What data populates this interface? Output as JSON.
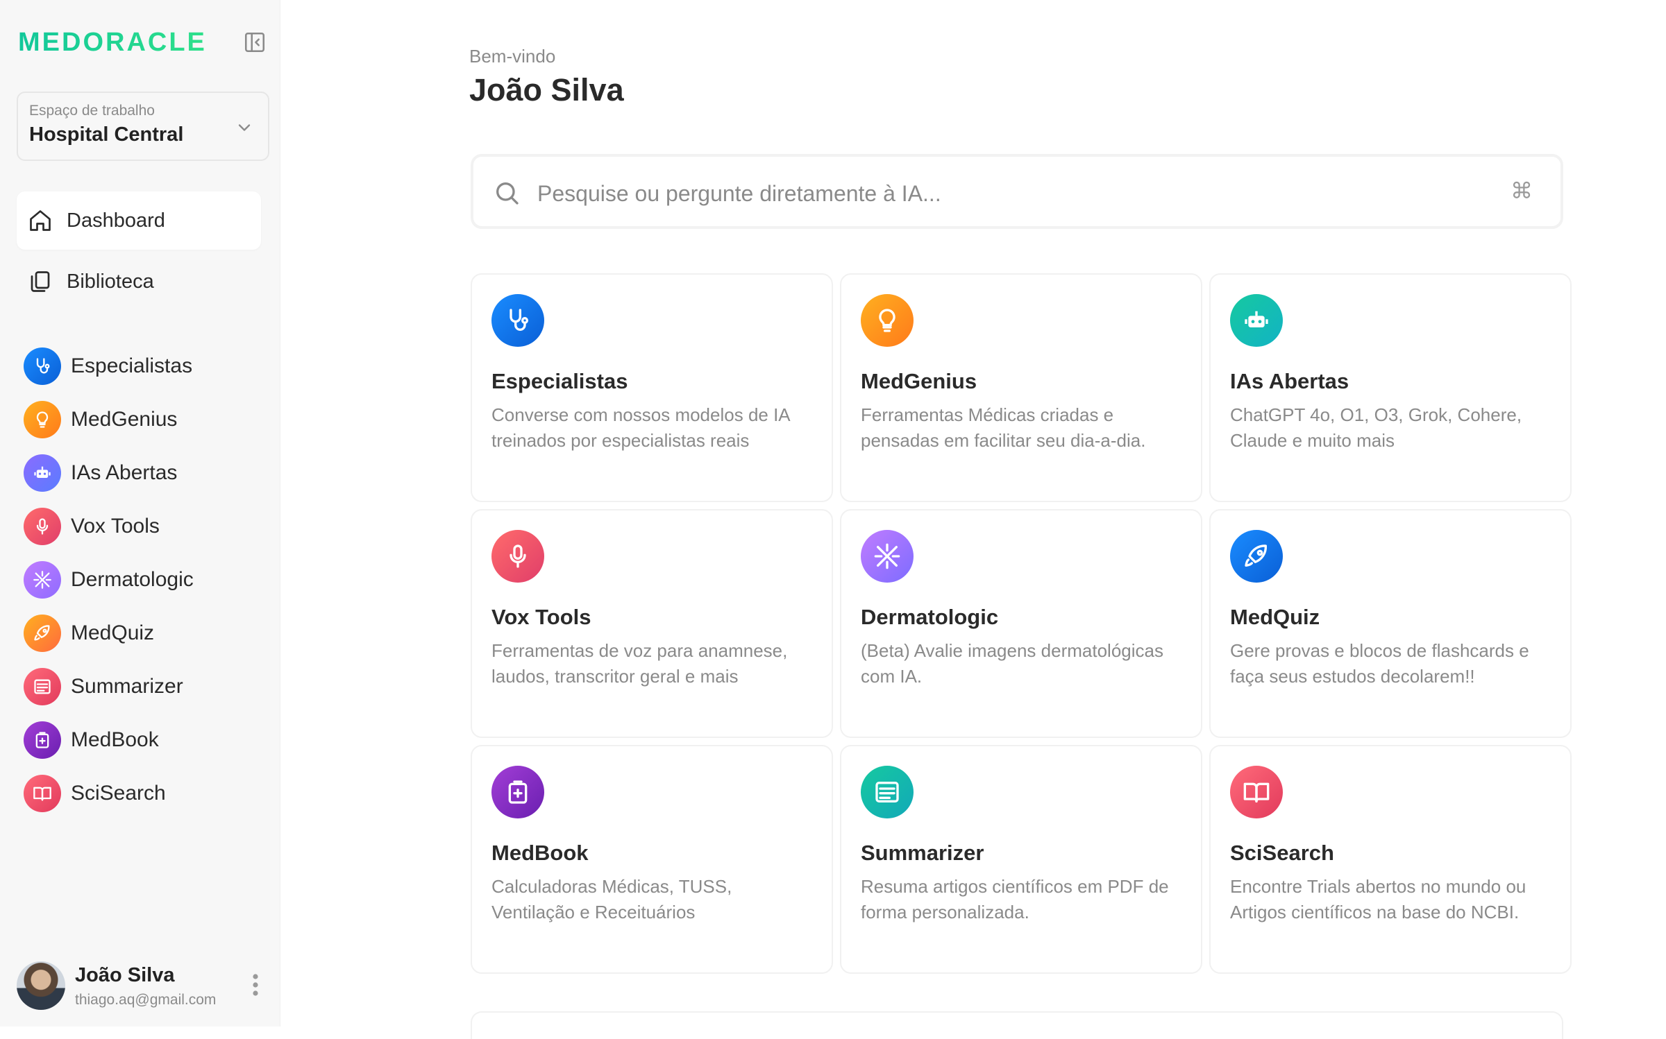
{
  "brand": {
    "name": "MEDORACLE"
  },
  "workspace": {
    "label": "Espaço de trabalho",
    "value": "Hospital Central"
  },
  "nav": [
    {
      "label": "Dashboard",
      "icon": "home-icon",
      "active": true
    },
    {
      "label": "Biblioteca",
      "icon": "library-icon",
      "active": false
    }
  ],
  "tools": [
    {
      "label": "Especialistas",
      "icon": "stethoscope-icon",
      "gradient": [
        "#1a8cff",
        "#0a5fd6"
      ]
    },
    {
      "label": "MedGenius",
      "icon": "lightbulb-icon",
      "gradient": [
        "#ffb020",
        "#ff7a1a"
      ]
    },
    {
      "label": "IAs Abertas",
      "icon": "robot-icon",
      "gradient": [
        "#8a6cff",
        "#5a7cff"
      ]
    },
    {
      "label": "Vox Tools",
      "icon": "microphone-icon",
      "gradient": [
        "#ff6b6b",
        "#e03e6a"
      ]
    },
    {
      "label": "Dermatologic",
      "icon": "virus-icon",
      "gradient": [
        "#c07cff",
        "#8f6cff"
      ]
    },
    {
      "label": "MedQuiz",
      "icon": "rocket-icon",
      "gradient": [
        "#ffb020",
        "#ff6a3d"
      ]
    },
    {
      "label": "Summarizer",
      "icon": "document-icon",
      "gradient": [
        "#ff6b7a",
        "#e23a5c"
      ]
    },
    {
      "label": "MedBook",
      "icon": "medical-book-icon",
      "gradient": [
        "#a23ed6",
        "#6a1fb0"
      ]
    },
    {
      "label": "SciSearch",
      "icon": "book-open-icon",
      "gradient": [
        "#ff6b7a",
        "#e23a5c"
      ]
    }
  ],
  "user": {
    "name": "João Silva",
    "email": "thiago.aq@gmail.com"
  },
  "main": {
    "welcome": "Bem-vindo",
    "user_name": "João Silva",
    "search_placeholder": "Pesquise ou pergunte diretamente à IA...",
    "search_shortcut": "⌘"
  },
  "cards": [
    {
      "title": "Especialistas",
      "desc": "Converse com nossos modelos de IA treinados por especialistas reais",
      "icon": "stethoscope-icon",
      "gradient": [
        "#1a8cff",
        "#0a5fd6"
      ]
    },
    {
      "title": "MedGenius",
      "desc": "Ferramentas Médicas criadas e pensadas em facilitar seu dia-a-dia.",
      "icon": "lightbulb-icon",
      "gradient": [
        "#ffb020",
        "#ff7a1a"
      ]
    },
    {
      "title": "IAs Abertas",
      "desc": "ChatGPT 4o, O1, O3, Grok, Cohere, Claude e muito mais",
      "icon": "robot-icon",
      "gradient": [
        "#16c9a0",
        "#12b3c4"
      ]
    },
    {
      "title": "Vox Tools",
      "desc": "Ferramentas de voz para anamnese, laudos, transcritor geral e mais",
      "icon": "microphone-icon",
      "gradient": [
        "#ff6b6b",
        "#e03e6a"
      ]
    },
    {
      "title": "Dermatologic",
      "desc": "(Beta) Avalie imagens dermatológicas com IA.",
      "icon": "virus-icon",
      "gradient": [
        "#c07cff",
        "#7d6cff"
      ]
    },
    {
      "title": "MedQuiz",
      "desc": "Gere provas e blocos de flashcards e faça seus estudos decolarem!!",
      "icon": "rocket-icon",
      "gradient": [
        "#1a8cff",
        "#0a5fd6"
      ]
    },
    {
      "title": "MedBook",
      "desc": "Calculadoras Médicas, TUSS, Ventilação e Receituários",
      "icon": "medical-book-icon",
      "gradient": [
        "#a23ed6",
        "#6a1fb0"
      ]
    },
    {
      "title": "Summarizer",
      "desc": "Resuma artigos científicos em PDF de forma personalizada.",
      "icon": "document-icon",
      "gradient": [
        "#16c9a0",
        "#12a9b8"
      ]
    },
    {
      "title": "SciSearch",
      "desc": "Encontre Trials abertos no mundo ou Artigos científicos na base do NCBI.",
      "icon": "book-open-icon",
      "gradient": [
        "#ff6b7a",
        "#e23a5c"
      ]
    }
  ]
}
